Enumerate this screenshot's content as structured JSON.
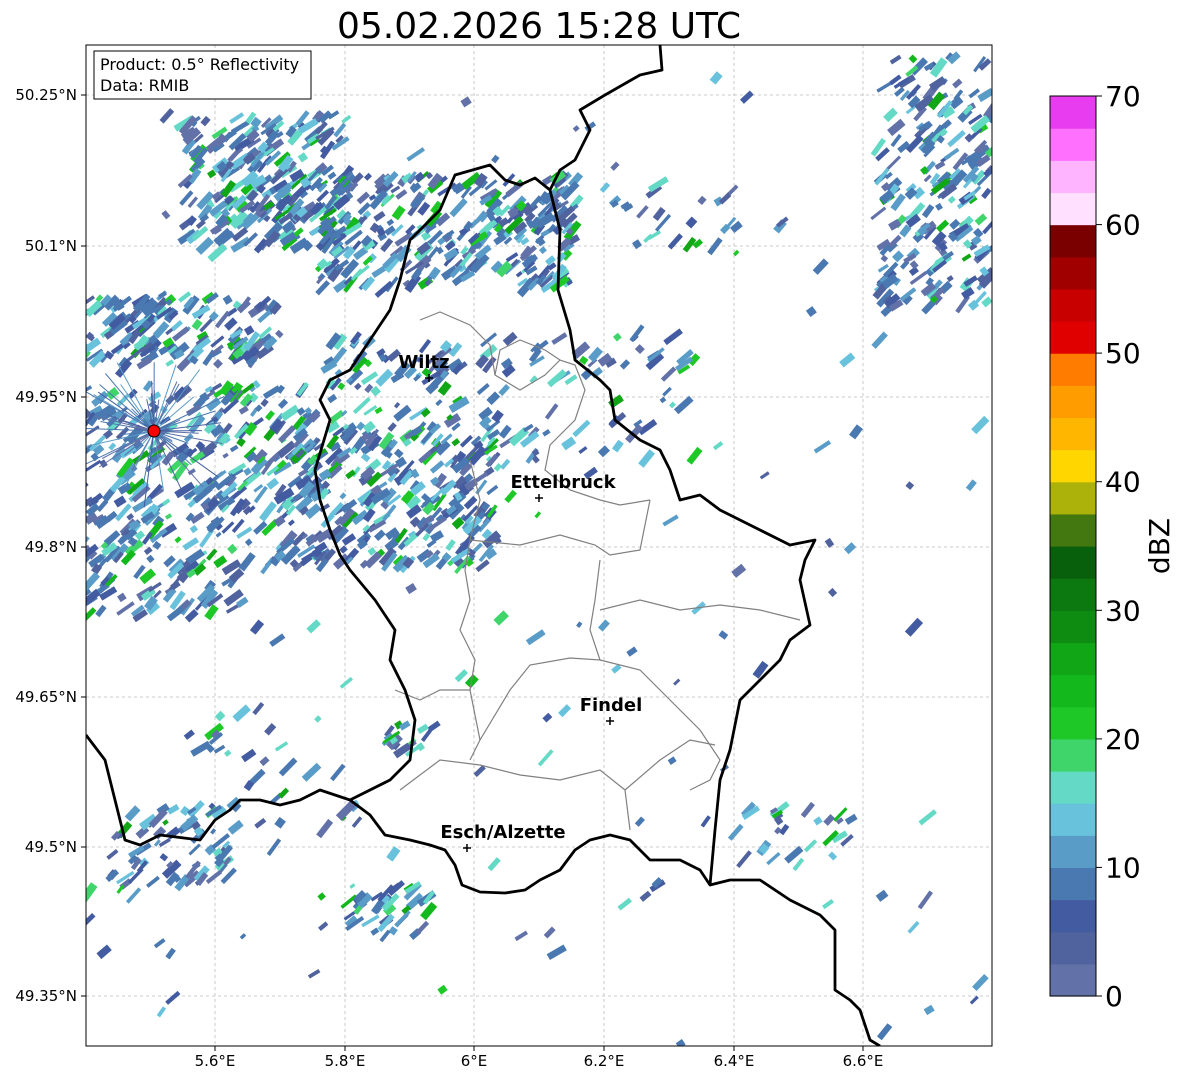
{
  "title": "05.02.2026 15:28 UTC",
  "info_box": {
    "product": "Product: 0.5° Reflectivity",
    "source": "Data: RMIB"
  },
  "latitude_ticks": [
    "50.25°N",
    "50.1°N",
    "49.95°N",
    "49.8°N",
    "49.65°N",
    "49.5°N",
    "49.35°N"
  ],
  "longitude_ticks": [
    "5.6°E",
    "5.8°E",
    "6°E",
    "6.2°E",
    "6.4°E",
    "6.6°E"
  ],
  "cities": [
    {
      "name": "Wiltz"
    },
    {
      "name": "Ettelbruck"
    },
    {
      "name": "Findel"
    },
    {
      "name": "Esch/Alzette"
    }
  ],
  "radar_site": {
    "color": "#ff0000"
  },
  "colorbar": {
    "label": "dBZ",
    "ticks": [
      "0",
      "10",
      "20",
      "30",
      "40",
      "50",
      "60",
      "70"
    ],
    "min": 0,
    "max": 70,
    "colors": [
      "#6272a8",
      "#51639e",
      "#435ba1",
      "#4a78b0",
      "#5a9cc8",
      "#68c2dc",
      "#63d9c6",
      "#3fd56a",
      "#1dc827",
      "#13b91c",
      "#11a616",
      "#0e8c12",
      "#0b7810",
      "#08600c",
      "#437810",
      "#acb20a",
      "#ffd600",
      "#ffb600",
      "#ff9c00",
      "#ff7c00",
      "#e10000",
      "#c80000",
      "#a00000",
      "#7a0000",
      "#ffe0ff",
      "#ffb4ff",
      "#ff70ff",
      "#e83cf0"
    ]
  }
}
